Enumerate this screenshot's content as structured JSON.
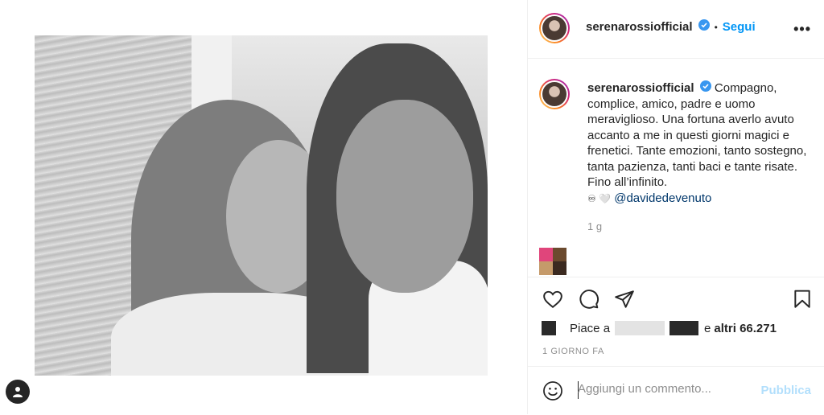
{
  "header": {
    "username": "serenarossiofficial",
    "separator": "•",
    "follow_label": "Segui",
    "more_label": "•••"
  },
  "caption": {
    "username": "serenarossiofficial",
    "text": "Compagno, complice, amico, padre e uomo meraviglioso. Una fortuna averlo avuto accanto a me in questi giorni magici e frenetici. Tante emozioni, tanto sostegno, tanta pazienza, tanti baci e tante risate. Fino all’infinito.",
    "emoji": "♾ 🤍",
    "mention": "@davidedevenuto",
    "time": "1 g"
  },
  "likes": {
    "prefix": "Piace a",
    "conjunction": "e",
    "others": "altri 66.271"
  },
  "post_date": "1 GIORNO FA",
  "comment": {
    "placeholder": "Aggiungi un commento...",
    "publish_label": "Pubblica"
  },
  "colors": {
    "accent": "#0095f6",
    "publish_disabled": "#b2dffc",
    "text": "#262626",
    "muted": "#8e8e8e",
    "mention": "#00376b"
  },
  "icons": [
    "heart-icon",
    "comment-icon",
    "share-icon",
    "bookmark-icon",
    "emoji-icon",
    "verified-icon",
    "user-avatar-icon"
  ]
}
